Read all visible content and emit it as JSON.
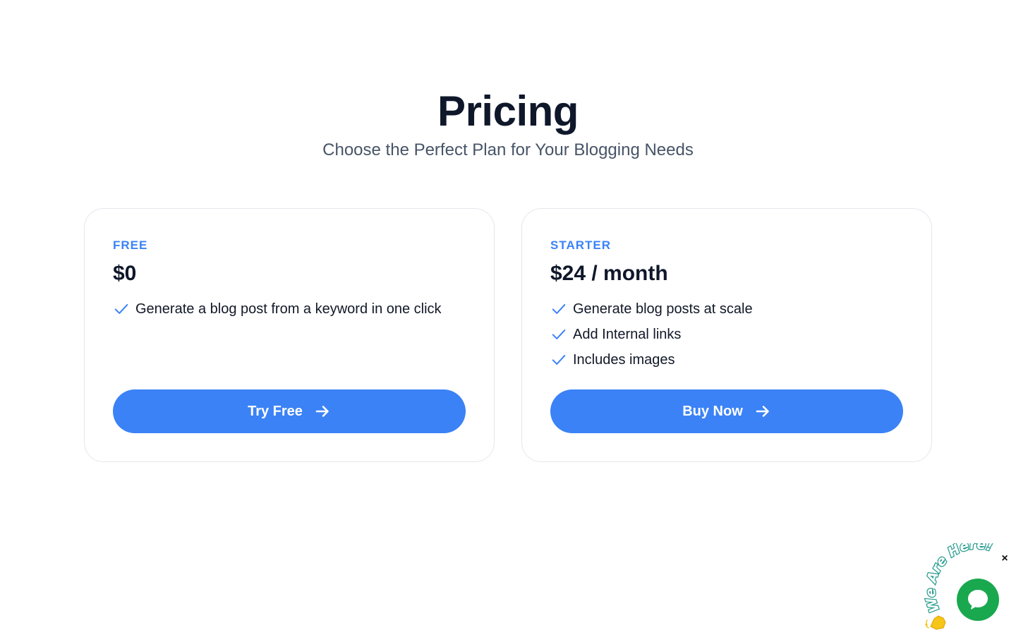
{
  "header": {
    "title": "Pricing",
    "subtitle": "Choose the Perfect Plan for Your Blogging Needs"
  },
  "plans": [
    {
      "name": "FREE",
      "price": "$0",
      "features": [
        "Generate a blog post from a keyword in one click"
      ],
      "cta_label": "Try Free"
    },
    {
      "name": "STARTER",
      "price": "$24 / month",
      "features": [
        "Generate blog posts at scale",
        "Add Internal links",
        "Includes images"
      ],
      "cta_label": "Buy Now"
    }
  ],
  "chat_widget": {
    "banner_text": "We Are Here!",
    "close_symbol": "×"
  },
  "colors": {
    "accent": "#3b82f6",
    "title": "#0f172a",
    "subtitle": "#475467",
    "card_border": "#e4e7ec",
    "chat_green": "#1aa84f"
  },
  "icons": {
    "feature": "check-icon",
    "cta": "arrow-right-icon",
    "chat": "chat-bubble-icon",
    "wave": "waving-hand-icon"
  }
}
